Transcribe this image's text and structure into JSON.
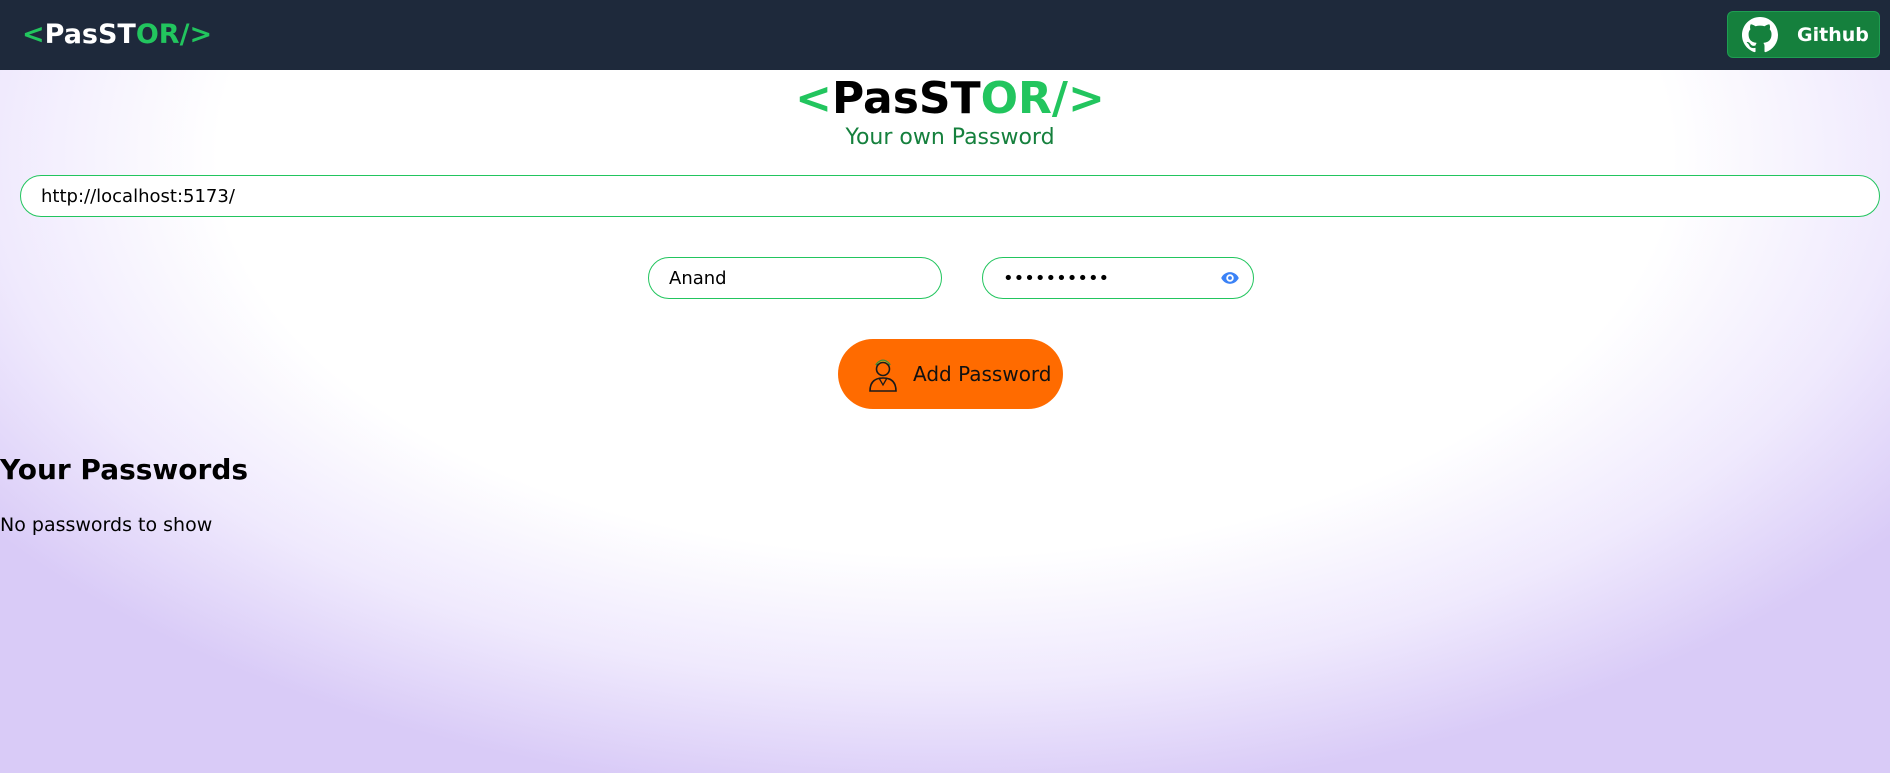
{
  "navbar": {
    "logo": {
      "lt": "<",
      "pas": "PasST",
      "or": "OR/",
      "gt": ">"
    },
    "github_label": "Github"
  },
  "hero": {
    "logo": {
      "lt": "<",
      "pas": "PasST",
      "or": "OR/",
      "gt": ">"
    },
    "tagline": "Your own Password"
  },
  "form": {
    "url_value": "http://localhost:5173/",
    "username_value": "Anand",
    "password_value": "••••••••••",
    "add_button_label": "Add Password"
  },
  "passwords": {
    "title": "Your Passwords",
    "empty_message": "No passwords to show"
  },
  "colors": {
    "navbar_bg": "#1e293b",
    "accent_green": "#22c55e",
    "dark_green": "#15803d",
    "add_button": "#ff6b00",
    "eye_icon": "#3b82f6"
  },
  "icons": [
    "github-icon",
    "eye-icon",
    "user-lock-icon"
  ]
}
